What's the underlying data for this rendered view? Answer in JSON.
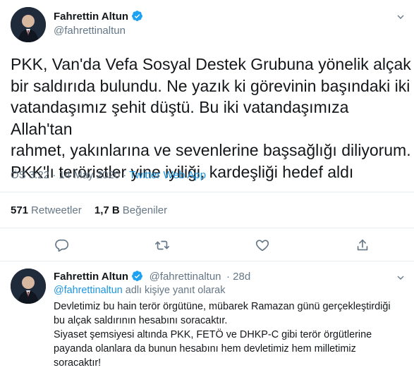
{
  "main_tweet": {
    "author_name": "Fahrettin Altun",
    "author_handle": "@fahrettinaltun",
    "text_lines": [
      "PKK, Van'da Vefa Sosyal Destek Grubuna yönelik alçak",
      "bir saldırıda bulundu. Ne yazık ki görevinin başındaki iki",
      "vatandaşımız şehit düştü. Bu iki vatandaşımıza Allah'tan",
      "rahmet, yakınlarına ve sevenlerine başsağlığı diliyorum.",
      "PKK'lı teröristler yine iyiliği, kardeşliği hedef aldı"
    ],
    "time": "ÖS 3:22 · 14 May 2020 · ",
    "source": "Twitter Web App",
    "retweet_count": "571",
    "retweet_label": "Retweetler",
    "like_count": "1,7 B",
    "like_label": "Beğeniler"
  },
  "actions": {
    "reply_icon": "reply-icon",
    "retweet_icon": "retweet-icon",
    "like_icon": "heart-icon",
    "share_icon": "share-icon"
  },
  "reply_tweet": {
    "author_name": "Fahrettin Altun",
    "author_handle": "@fahrettinaltun",
    "age": "· 28d",
    "mention": "@fahrettinaltun",
    "reply_context": " adlı kişiye yanıt olarak",
    "text_lines": [
      "Devletimiz bu hain terör örgütüne, mübarek Ramazan günü gerçekleştirdiği",
      "bu alçak saldırının hesabını soracaktır.",
      "Siyaset şemsiyesi altında PKK, FETÖ ve DHKP-C gibi terör örgütlerine",
      "payanda olanlara da bunun hesabını hem devletimiz hem milletimiz",
      "soracaktır!"
    ]
  },
  "colors": {
    "accent": "#1b95e0",
    "muted": "#657786",
    "divider": "#e6ecf0",
    "text": "#14171a"
  }
}
